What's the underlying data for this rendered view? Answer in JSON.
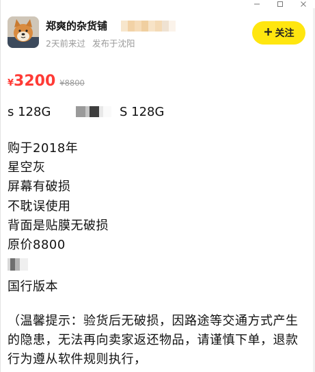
{
  "window": {
    "controls": [
      "minimize",
      "maximize",
      "close"
    ]
  },
  "seller": {
    "name": "郑爽的杂货铺",
    "last_visit": "2天前来过",
    "location": "发布于沈阳",
    "follow_label": "关注",
    "avatar_icon": "shiba-dog-avatar"
  },
  "price": {
    "symbol": "¥",
    "current": "3200",
    "original": "¥8800",
    "accent_color": "#ff3b36"
  },
  "model": {
    "part_a": "s 128G",
    "part_b": "S 128G"
  },
  "description": {
    "lines": [
      "购于2018年",
      "星空灰",
      "屏幕有破损",
      "不耽误使用",
      "背面是贴膜无破损",
      "原价8800"
    ],
    "after_mosaic": "国行版本"
  },
  "tip": {
    "text": "（温馨提示：验货后无破损，因路途等交通方式产生的隐患，无法再向卖家返还物品，请谨慎下单，退款行为遵从软件规则执行，"
  },
  "colors": {
    "follow_button": "#ffe60f",
    "meta_text": "#9a9a9a"
  }
}
